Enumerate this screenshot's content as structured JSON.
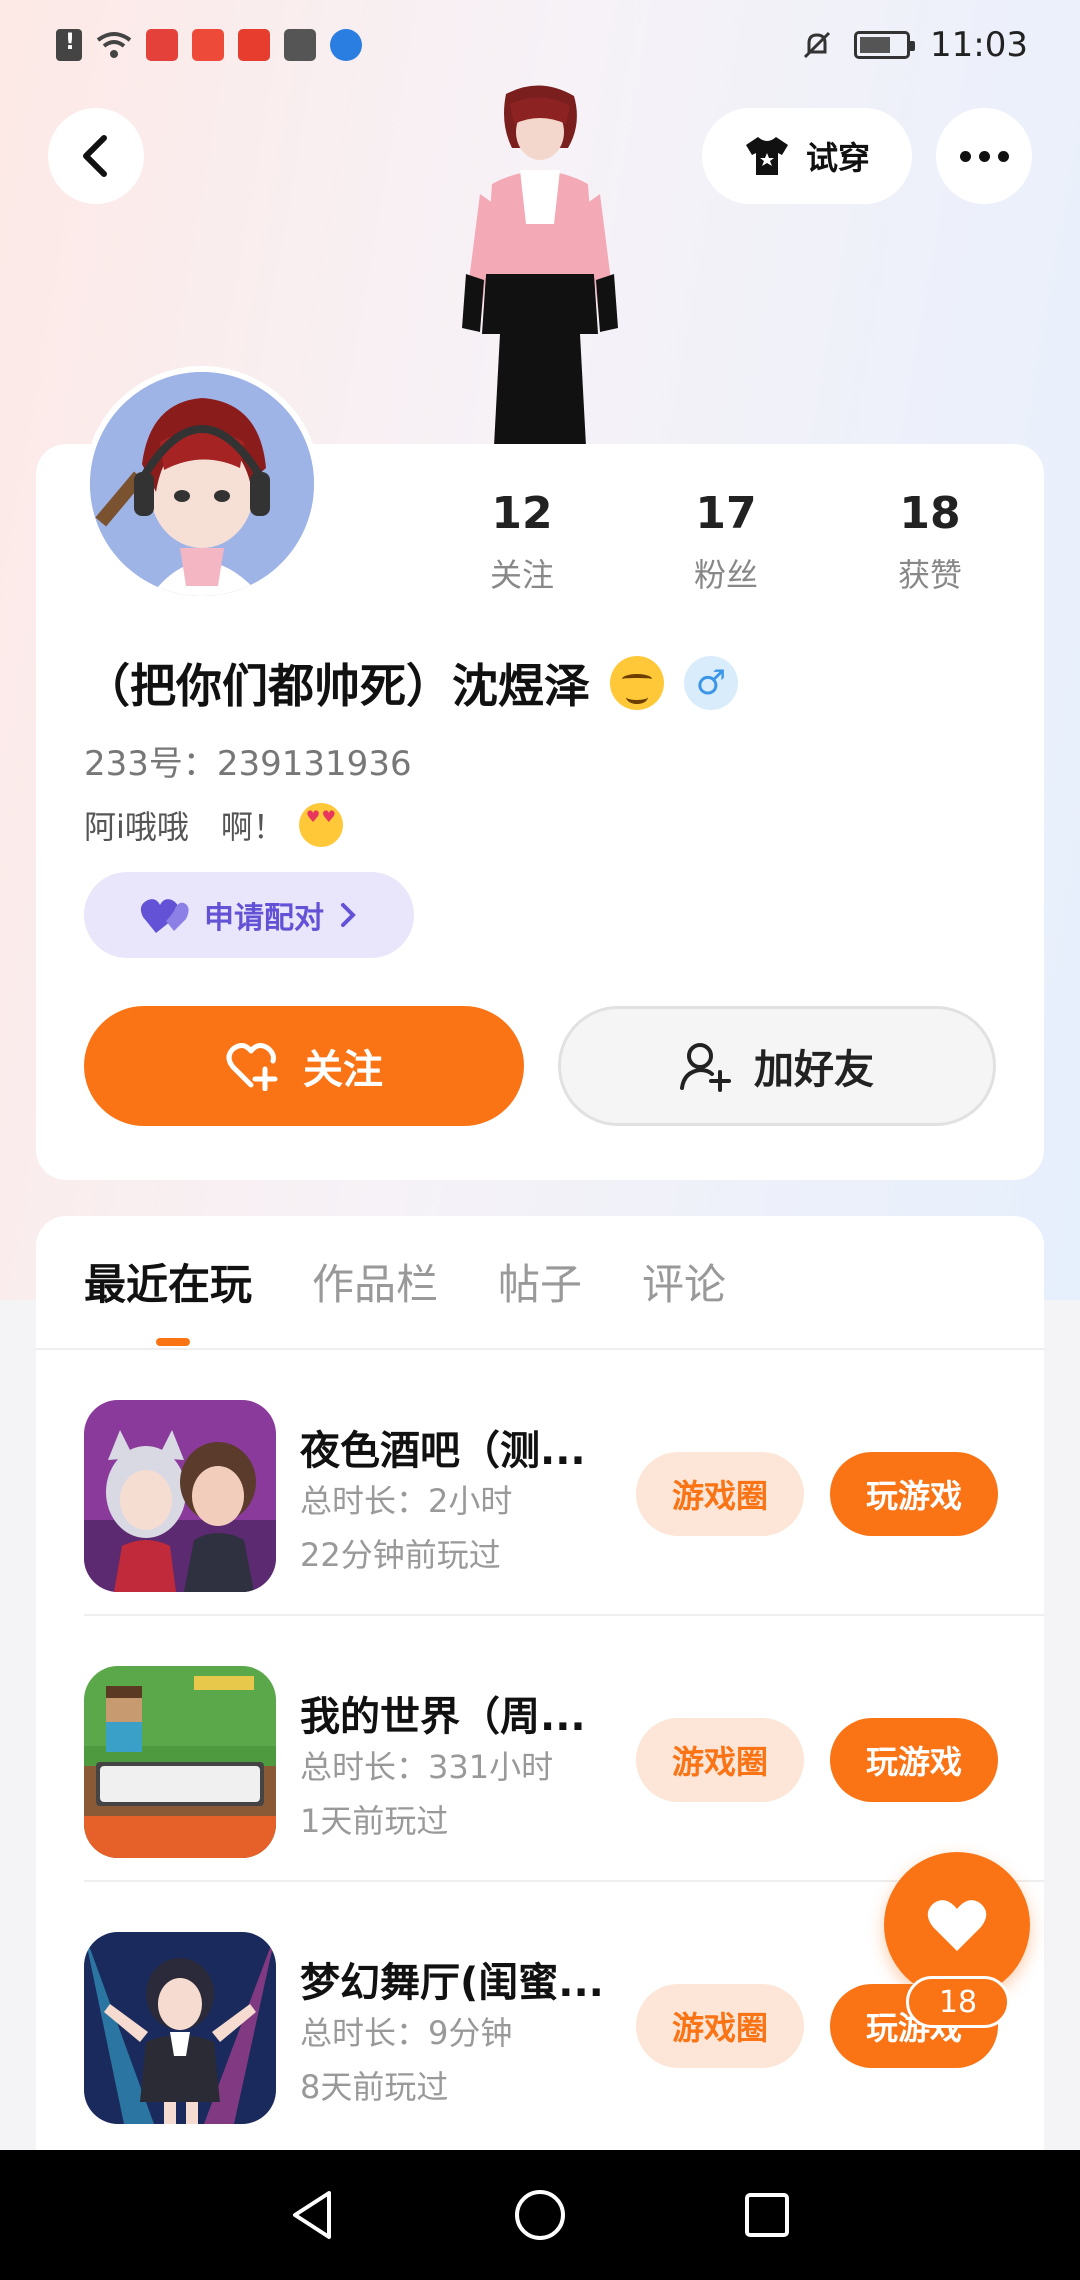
{
  "status_bar": {
    "time": "11:03"
  },
  "header": {
    "tryon_label": "试穿"
  },
  "profile": {
    "stats": [
      {
        "num": "12",
        "label": "关注"
      },
      {
        "num": "17",
        "label": "粉丝"
      },
      {
        "num": "18",
        "label": "获赞"
      }
    ],
    "nickname": "（把你们都帅死）沈煜泽",
    "gender_symbol": "♂",
    "uid": "233号：239131936",
    "bio": "阿i哦哦　啊！",
    "pair_label": "申请配对",
    "follow_label": "关注",
    "add_friend_label": "加好友"
  },
  "tabs": [
    "最近在玩",
    "作品栏",
    "帖子",
    "评论"
  ],
  "games": [
    {
      "title": "夜色酒吧（测...",
      "duration": "总时长：2小时",
      "last_played": "22分钟前玩过",
      "circle_label": "游戏圈",
      "play_label": "玩游戏"
    },
    {
      "title": "我的世界（周...",
      "duration": "总时长：331小时",
      "last_played": "1天前玩过",
      "circle_label": "游戏圈",
      "play_label": "玩游戏"
    },
    {
      "title": "梦幻舞厅(闺蜜...",
      "duration": "总时长：9分钟",
      "last_played": "8天前玩过",
      "circle_label": "游戏圈",
      "play_label": "玩游戏"
    }
  ],
  "like_fab": {
    "count": "18"
  },
  "colors": {
    "accent": "#fa7416",
    "pair_bg": "#e9e5fb",
    "pair_text": "#6352d6"
  }
}
